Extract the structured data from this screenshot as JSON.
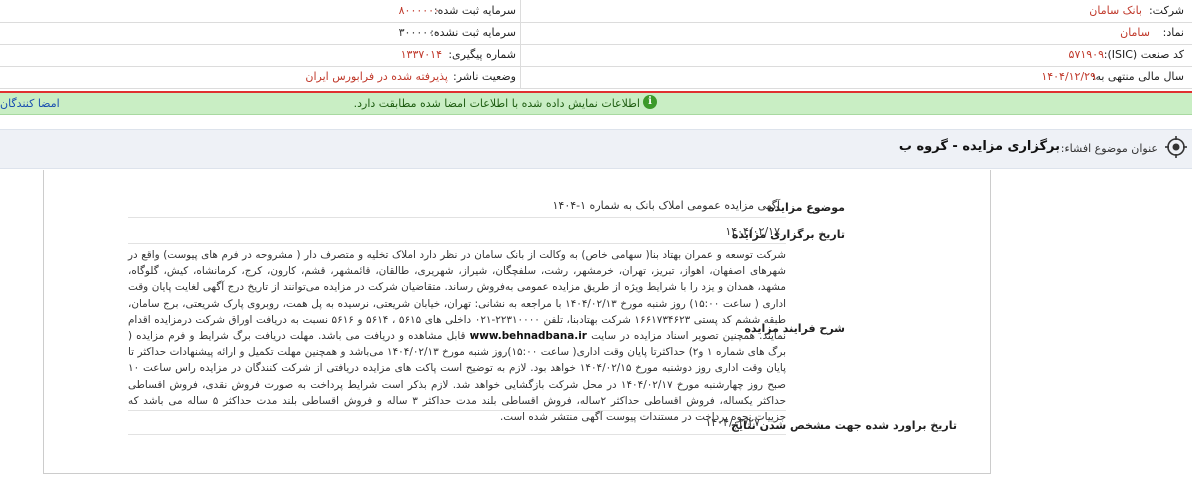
{
  "header": {
    "company_label": "شرکت:",
    "company_value": "بانک سامان",
    "symbol_label": "نماد:",
    "symbol_value": "سامان",
    "isic_label": "کد صنعت (ISIC):",
    "isic_value": "۵۷۱۹۰۹",
    "fiscal_label": "سال مالی منتهی به:",
    "fiscal_value": "۱۴۰۴/۱۲/۲۹",
    "reg_capital_label": "سرمایه ثبت شده:",
    "reg_capital_value": "۸۰۰۰۰۰۰",
    "unreg_capital_label": "سرمایه ثبت نشده:",
    "unreg_capital_value": "۳۰۰۰۰۰۰",
    "tracking_label": "شماره پیگیری:",
    "tracking_value": "۱۳۳۷۰۱۴",
    "status_label": "وضعیت ناشر:",
    "status_value": "پذیرفته شده در فرابورس ایران"
  },
  "notice": {
    "message": "اطلاعات نمایش داده شده با اطلاعات امضا شده مطابقت دارد.",
    "signers_link": "امضا کنندگان"
  },
  "subject": {
    "label": "عنوان موضوع افشاء:",
    "title": "برگزاری مزایده - گروه ب"
  },
  "details": {
    "topic_label": "موضوع مزایده",
    "topic_value": "آگهی مزایده عمومی املاک بانک به شماره ۱-۱۴۰۴",
    "date_label": "تاریخ برگزاری مزایده",
    "date_value": "۱۴۰۴/۰۲/۱۷",
    "process_label": "شرح فرایند مزایده",
    "process_text_1": "شرکت توسعه و عمران بهتاد بنا( سهامی خاص) به وکالت از بانک سامان در نظر دارد املاک تخلیه و متصرف دار ( مشروحه در فرم های پیوست) واقع در شهرهای اصفهان، اهواز، تبریز، تهران، خرمشهر، رشت، سلفچگان، شیراز، شهریری، طالقان، قائمشهر، قشم، کارون، کرج، کرمانشاه، کیش، گلوگاه، مشهد، همدان و یزد را با شرایط ویژه از طریق مزایده عمومی به‌فروش رساند. متقاضیان شرکت در مزایده می‌توانند از تاریخ درج آگهی لغایت پایان وقت اداری ( ساعت ۱۵:۰۰) روز شنبه مورخ ۱۴۰۴/۰۲/۱۳ با مراجعه به نشانی: تهران، خیابان شریعتی، نرسیده به پل همت، روبروی پارک شریعتی، برج سامان، طبقه ششم کد پستی ۱۶۶۱۷۳۴۶۲۳ شرکت بهتادبنا، تلفن ۲۲۳۱۰۰۰۰-۰۲۱ داخلی های ۵۶۱۵ ، ۵۶۱۴ و ۵۶۱۶ نسبت به دریافت اوراق شرکت درمزایده اقدام نمایند. همچنین تصویر اسناد مزایده در سایت",
    "process_link": "www.behnadbana.ir",
    "process_text_2": "قابل مشاهده و دریافت می باشد. مهلت دریافت برگ شرایط و فرم مزایده ( برگ های شماره ۱ و۲) حداکثرتا پایان وقت اداری( ساعت ۱۵:۰۰)روز شنبه مورخ ۱۴۰۴/۰۲/۱۳ می‌باشد و همچنین مهلت تکمیل و ارائه پیشنهادات حداکثر تا پایان وقت اداری روز دوشنبه مورخ ۱۴۰۴/۰۲/۱۵ خواهد بود. لازم به توضیح است پاکت های مزایده دریافتی از شرکت کنندگان در مزایده راس ساعت ۱۰ صبح روز چهارشنبه مورخ ۱۴۰۴/۰۲/۱۷ در محل شرکت بازگشایی خواهد شد. لازم بذکر است شرایط پرداخت به صورت فروش نقدی، فروش اقساطی حداکثر یکساله، فروش اقساطی حداکثر ۲ساله، فروش اقساطی بلند مدت حداکثر ۳ ساله و فروش اقساطی بلند مدت حداکثر ۵ ساله می باشد که جزییات نحوه پرداخت در مستندات پیوست آگهی منتشر شده است.",
    "results_label": "تاریخ براورد شده جهت مشخص شدن نتایج",
    "results_value": "۱۴۰۴/۰۲/۲۷"
  }
}
